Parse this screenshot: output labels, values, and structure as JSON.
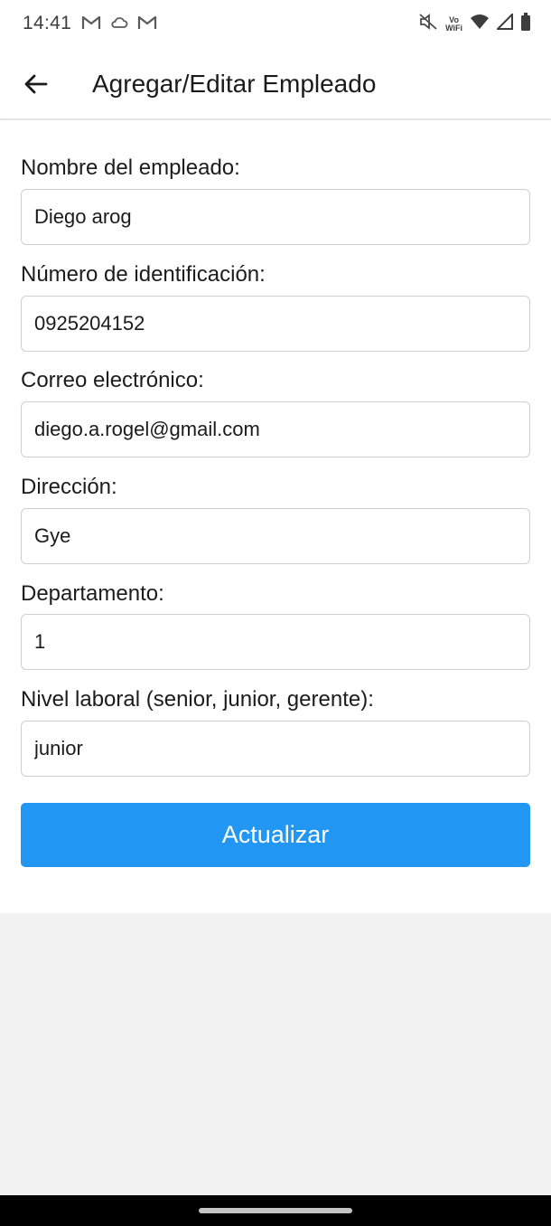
{
  "status_bar": {
    "time": "14:41",
    "left_icons": [
      "gmail-icon",
      "cloud-icon",
      "gmail-icon"
    ],
    "right_icons": [
      "mute-icon",
      "vowifi-icon",
      "wifi-icon",
      "signal-icon",
      "battery-icon"
    ],
    "wifi_label_top": "Vo",
    "wifi_label_bottom": "WiFi"
  },
  "app_bar": {
    "title": "Agregar/Editar Empleado",
    "back_icon": "arrow-left-icon"
  },
  "form": {
    "fields": [
      {
        "label": "Nombre del empleado:",
        "value": "Diego arog"
      },
      {
        "label": "Número de identificación:",
        "value": "0925204152"
      },
      {
        "label": "Correo electrónico:",
        "value": "diego.a.rogel@gmail.com"
      },
      {
        "label": "Dirección:",
        "value": "Gye"
      },
      {
        "label": "Departamento:",
        "value": "1"
      },
      {
        "label": "Nivel laboral (senior, junior, gerente):",
        "value": "junior"
      }
    ],
    "submit_label": "Actualizar"
  },
  "colors": {
    "accent": "#2196f3",
    "background": "#f2f2f2",
    "surface": "#ffffff"
  }
}
